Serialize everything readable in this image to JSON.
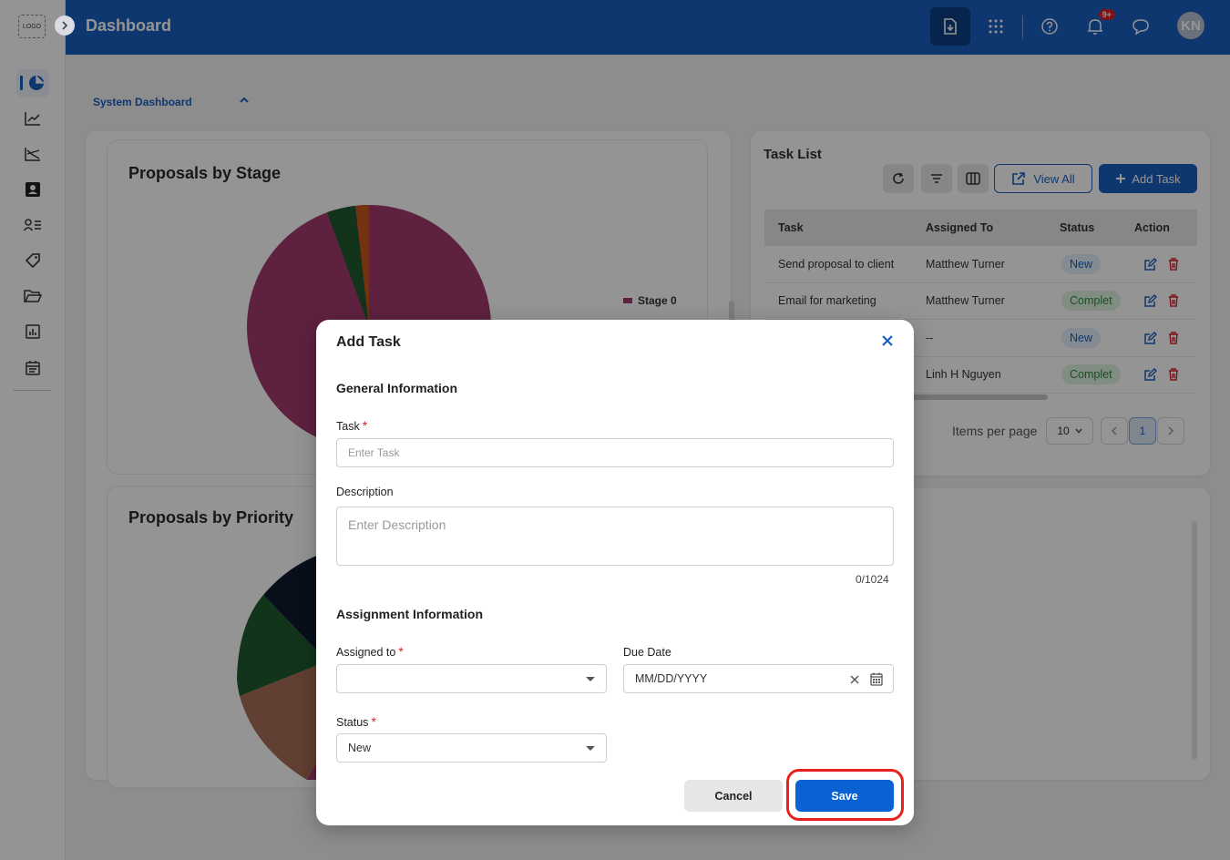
{
  "app": {
    "logo_text": "LOGO",
    "header_title": "Dashboard",
    "notification_badge": "9+",
    "avatar_initials": "KN",
    "brand_color": "#1a5fc0"
  },
  "sidebar": {
    "items": [
      {
        "icon": "pie-chart-icon",
        "active": true
      },
      {
        "icon": "line-chart-icon"
      },
      {
        "icon": "trend-chart-icon"
      },
      {
        "icon": "contacts-icon"
      },
      {
        "icon": "user-list-icon"
      },
      {
        "icon": "tag-icon"
      },
      {
        "icon": "folder-icon"
      },
      {
        "icon": "report-icon"
      },
      {
        "icon": "calendar-icon"
      }
    ]
  },
  "dashboard": {
    "section_label": "System Dashboard",
    "card1_title": "Proposals by Stage",
    "card1_legend": "Stage 0",
    "card2_title": "Proposals by Priority"
  },
  "task_list": {
    "title": "Task List",
    "view_all_label": "View All",
    "add_task_label": "Add Task",
    "columns": [
      "Task",
      "Assigned To",
      "Status",
      "Action"
    ],
    "rows": [
      {
        "task": "Send proposal to client",
        "assigned": "Matthew Turner",
        "status": "New"
      },
      {
        "task": "Email for marketing",
        "assigned": "Matthew Turner",
        "status": "Complet"
      },
      {
        "task": "",
        "assigned": "--",
        "status": "New"
      },
      {
        "task": "",
        "assigned": "Linh H Nguyen",
        "status": "Complet"
      }
    ],
    "items_per_page_label": "Items per page",
    "items_per_page": "10",
    "current_page": "1"
  },
  "modal": {
    "title": "Add Task",
    "general_section": "General Information",
    "task_label": "Task",
    "task_placeholder": "Enter Task",
    "description_label": "Description",
    "description_placeholder": "Enter Description",
    "char_counter": "0/1024",
    "assignment_section": "Assignment Information",
    "assigned_label": "Assigned to",
    "assigned_value": "",
    "due_label": "Due Date",
    "due_placeholder": "MM/DD/YYYY",
    "status_label": "Status",
    "status_value": "New",
    "cancel_label": "Cancel",
    "save_label": "Save"
  },
  "chart_data": [
    {
      "type": "pie",
      "title": "Proposals by Stage",
      "legend": [
        "Stage 0"
      ],
      "colors": [
        "#a3396f",
        "#1f5a30",
        "#c8561c"
      ]
    },
    {
      "type": "pie",
      "title": "Proposals by Priority",
      "colors": [
        "#0e1a2e",
        "#1f5a30",
        "#a86d57",
        "#a3396f"
      ]
    }
  ]
}
